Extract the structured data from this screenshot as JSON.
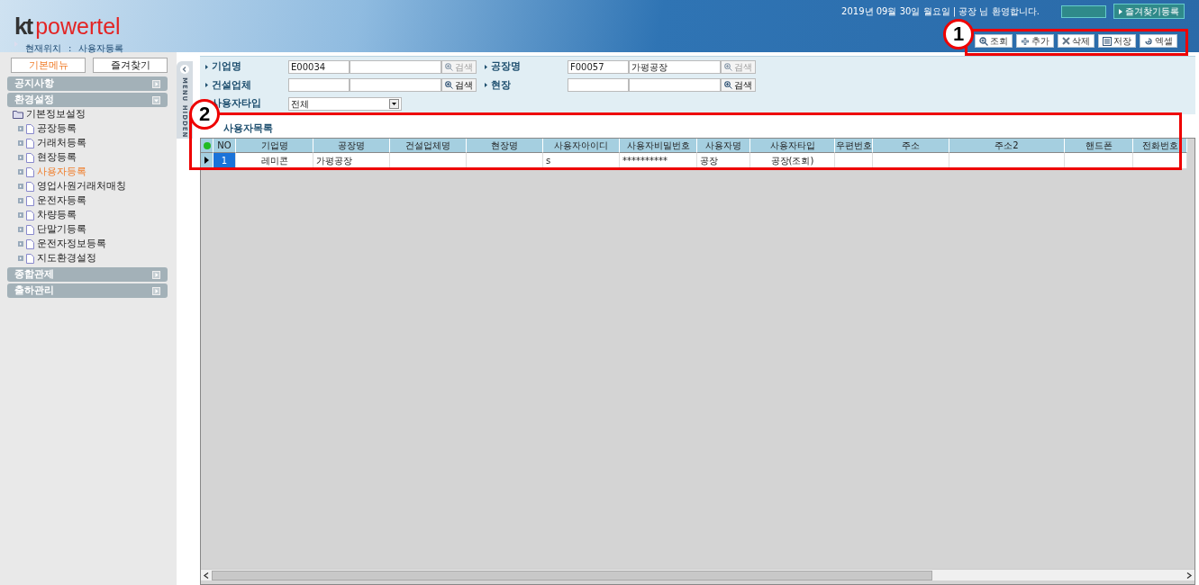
{
  "header": {
    "logo_mark": "kt",
    "logo_text": "powertel",
    "location_label": "현재위치",
    "location_separator": ":",
    "location": "사용자등록",
    "greeting": "2019년 09월 30일 월요일 | 공장 님 환영합니다.",
    "links": [
      {
        "label": "즐겨찾기등록"
      }
    ]
  },
  "toolbar": [
    {
      "kind": "search",
      "label": "조회"
    },
    {
      "kind": "add",
      "label": "추가"
    },
    {
      "kind": "delete",
      "label": "삭제"
    },
    {
      "kind": "save",
      "label": "저장"
    },
    {
      "kind": "excel",
      "label": "엑셀"
    }
  ],
  "annotations": [
    {
      "label": "1"
    },
    {
      "label": "2"
    }
  ],
  "sidebar": {
    "tabs": [
      {
        "label": "기본메뉴",
        "selected": true
      },
      {
        "label": "즐겨찾기",
        "selected": false
      }
    ],
    "sections": [
      {
        "title": "공지사항",
        "expanded": false
      },
      {
        "title": "환경설정",
        "expanded": true,
        "children": [
          {
            "label": "기본정보설정",
            "children": [
              {
                "label": "공장등록",
                "selected": false
              },
              {
                "label": "거래처등록",
                "selected": false
              },
              {
                "label": "현장등록",
                "selected": false
              },
              {
                "label": "사용자등록",
                "selected": true
              },
              {
                "label": "영업사원거래처매칭",
                "selected": false
              },
              {
                "label": "운전자등록",
                "selected": false
              },
              {
                "label": "차량등록",
                "selected": false
              },
              {
                "label": "단말기등록",
                "selected": false
              },
              {
                "label": "운전자정보등록",
                "selected": false
              },
              {
                "label": "지도환경설정",
                "selected": false
              }
            ]
          }
        ]
      },
      {
        "title": "종합관제",
        "expanded": false
      },
      {
        "title": "출하관리",
        "expanded": false
      }
    ]
  },
  "menu_toggle": {
    "label": "MENU HIDDEN"
  },
  "search_form": {
    "rows": [
      [
        {
          "kind": "lookup",
          "label": "기업명",
          "code": "E00034",
          "button": "검색",
          "disabled": true
        },
        {
          "kind": "lookup",
          "label": "공장명",
          "code": "F00057",
          "name": "가평공장",
          "button": "검색",
          "disabled": true
        }
      ],
      [
        {
          "kind": "lookup",
          "label": "건설업체",
          "button": "검색",
          "disabled": false
        },
        {
          "kind": "lookup",
          "label": "현장",
          "button": "검색",
          "disabled": false
        }
      ],
      [
        {
          "kind": "select",
          "label": "사용자타입",
          "value": "전체"
        }
      ]
    ]
  },
  "user_list": {
    "title": "사용자목록",
    "columns": [
      "NO",
      "기업명",
      "공장명",
      "건설업체명",
      "현장명",
      "사용자아이디",
      "사용자비밀번호",
      "사용자명",
      "사용자타입",
      "우편번호",
      "주소",
      "주소2",
      "핸드폰",
      "전화번호"
    ],
    "rows": [
      {
        "selected": true,
        "cells": [
          "1",
          "레미콘",
          "가평공장",
          "",
          "",
          "s",
          "**********",
          "공장",
          "공장(조회)",
          "",
          "",
          "",
          "",
          ""
        ]
      }
    ]
  }
}
